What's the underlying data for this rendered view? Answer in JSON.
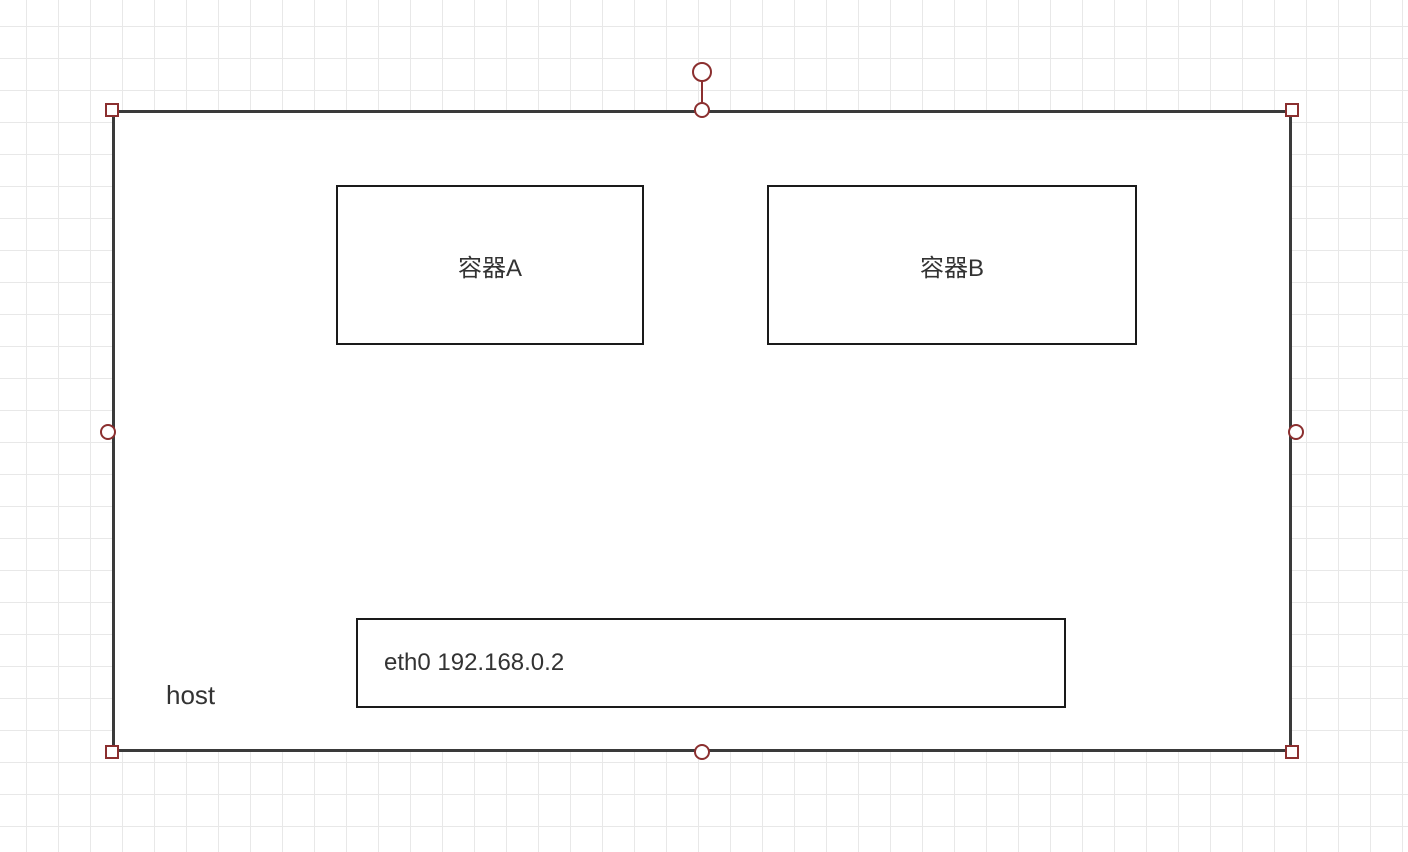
{
  "host": {
    "label": "host"
  },
  "containers": {
    "a": {
      "label": "容器A"
    },
    "b": {
      "label": "容器B"
    }
  },
  "eth": {
    "label": "eth0 192.168.0.2"
  }
}
